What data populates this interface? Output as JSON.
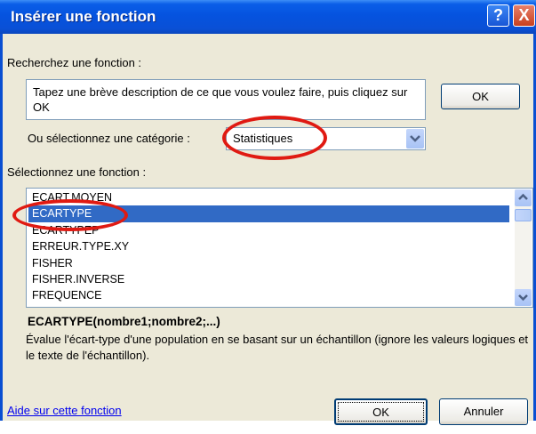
{
  "window": {
    "title": "Insérer une fonction"
  },
  "titlebar": {
    "help_label": "?",
    "close_label": "X"
  },
  "search": {
    "label": "Recherchez une fonction :",
    "text": "Tapez une brève description de ce que vous voulez faire, puis cliquez sur OK",
    "ok_label": "OK"
  },
  "category": {
    "label": "Ou sélectionnez une catégorie :",
    "value": "Statistiques"
  },
  "function_list": {
    "label": "Sélectionnez une fonction :",
    "items": [
      "ECART.MOYEN",
      "ECARTYPE",
      "ECARTYPEP",
      "ERREUR.TYPE.XY",
      "FISHER",
      "FISHER.INVERSE",
      "FREQUENCE"
    ],
    "selected": "ECARTYPE"
  },
  "description": {
    "signature": "ECARTYPE(nombre1;nombre2;...)",
    "text": "Évalue l'écart-type d'une population en se basant sur un échantillon (ignore les valeurs logiques et le texte de l'échantillon)."
  },
  "footer": {
    "help_link": "Aide sur cette fonction",
    "ok_label": "OK",
    "cancel_label": "Annuler"
  },
  "icons": {
    "combo_arrow": "chevron-down-icon",
    "scroll_up": "chevron-up-icon",
    "scroll_down": "chevron-down-icon"
  },
  "colors": {
    "title_bar": "#0553df",
    "selection": "#316ac5",
    "annotation": "#e01a12"
  }
}
